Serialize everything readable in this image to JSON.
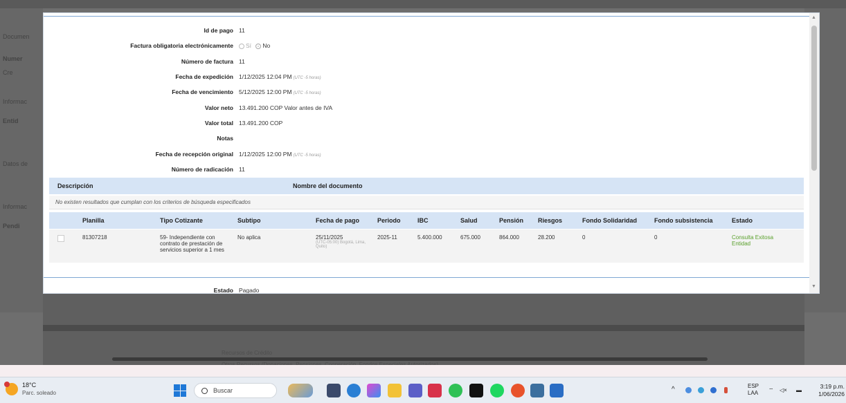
{
  "background": {
    "left_labels": [
      "Documen",
      "Numer",
      "Cre",
      "Informac",
      "Entid",
      "Datos de",
      "Informac",
      "Pendi"
    ],
    "lower_texts": [
      "Recursos de Crédito",
      "Otros Recursos (Donaciones, Pensiones, Cooperación, Fondos Especiales Autorizados)"
    ]
  },
  "form": {
    "id_pago": {
      "label": "Id de pago",
      "value": "11"
    },
    "factura_obligatoria": {
      "label": "Factura obligatoria electrónicamente",
      "opt_si": "Sí",
      "opt_no": "No"
    },
    "numero_factura": {
      "label": "Número de factura",
      "value": "11"
    },
    "fecha_expedicion": {
      "label": "Fecha de expedición",
      "value": "1/12/2025 12:04 PM",
      "tz": "(UTC -5 horas)"
    },
    "fecha_vencimiento": {
      "label": "Fecha de vencimiento",
      "value": "5/12/2025 12:00 PM",
      "tz": "(UTC -5 horas)"
    },
    "valor_neto": {
      "label": "Valor neto",
      "value": "13.491.200 COP Valor antes de IVA"
    },
    "valor_total": {
      "label": "Valor total",
      "value": "13.491.200 COP"
    },
    "notas": {
      "label": "Notas",
      "value": ""
    },
    "fecha_recepcion": {
      "label": "Fecha de recepción original",
      "value": "1/12/2025 12:00 PM",
      "tz": "(UTC -5 horas)"
    },
    "numero_radicacion": {
      "label": "Número de radicación",
      "value": "11"
    }
  },
  "documents_table": {
    "headers": [
      "Descripción",
      "Nombre del documento"
    ],
    "empty_message": "No existen resultados que cumplan con los criterios de búsqueda especificados"
  },
  "planilla_table": {
    "headers": [
      "Planilla",
      "Tipo Cotizante",
      "Subtipo",
      "Fecha de pago",
      "Periodo",
      "IBC",
      "Salud",
      "Pensión",
      "Riesgos",
      "Fondo Solidaridad",
      "Fondo subsistencia",
      "Estado"
    ],
    "rows": [
      {
        "planilla": "81307218",
        "tipo": "59- Independiente con contrato de prestación de servicios superior a 1 mes",
        "subtipo": "No aplica",
        "fecha": "25/11/2025",
        "fecha_tz": "(UTC-05:00) Bogotá, Lima, Quito)",
        "periodo": "2025-11",
        "ibc": "5.400.000",
        "salud": "675.000",
        "pension": "864.000",
        "riesgos": "28.200",
        "fondo_solidaridad": "0",
        "fondo_subsistencia": "0",
        "estado": "Consulta Exitosa Entidad"
      }
    ]
  },
  "estado": {
    "label": "Estado",
    "value": "Pagado"
  },
  "taskbar": {
    "temp": "18°C",
    "condition": "Parc. soleado",
    "search_placeholder": "Buscar",
    "lang1": "ESP",
    "lang2": "LAA",
    "time": "3:19 p.m.",
    "date": "1/06/2026"
  },
  "colors": {
    "table_header": "#d6e4f5",
    "success": "#5aa02c",
    "accent_line": "#7fa7d3"
  }
}
